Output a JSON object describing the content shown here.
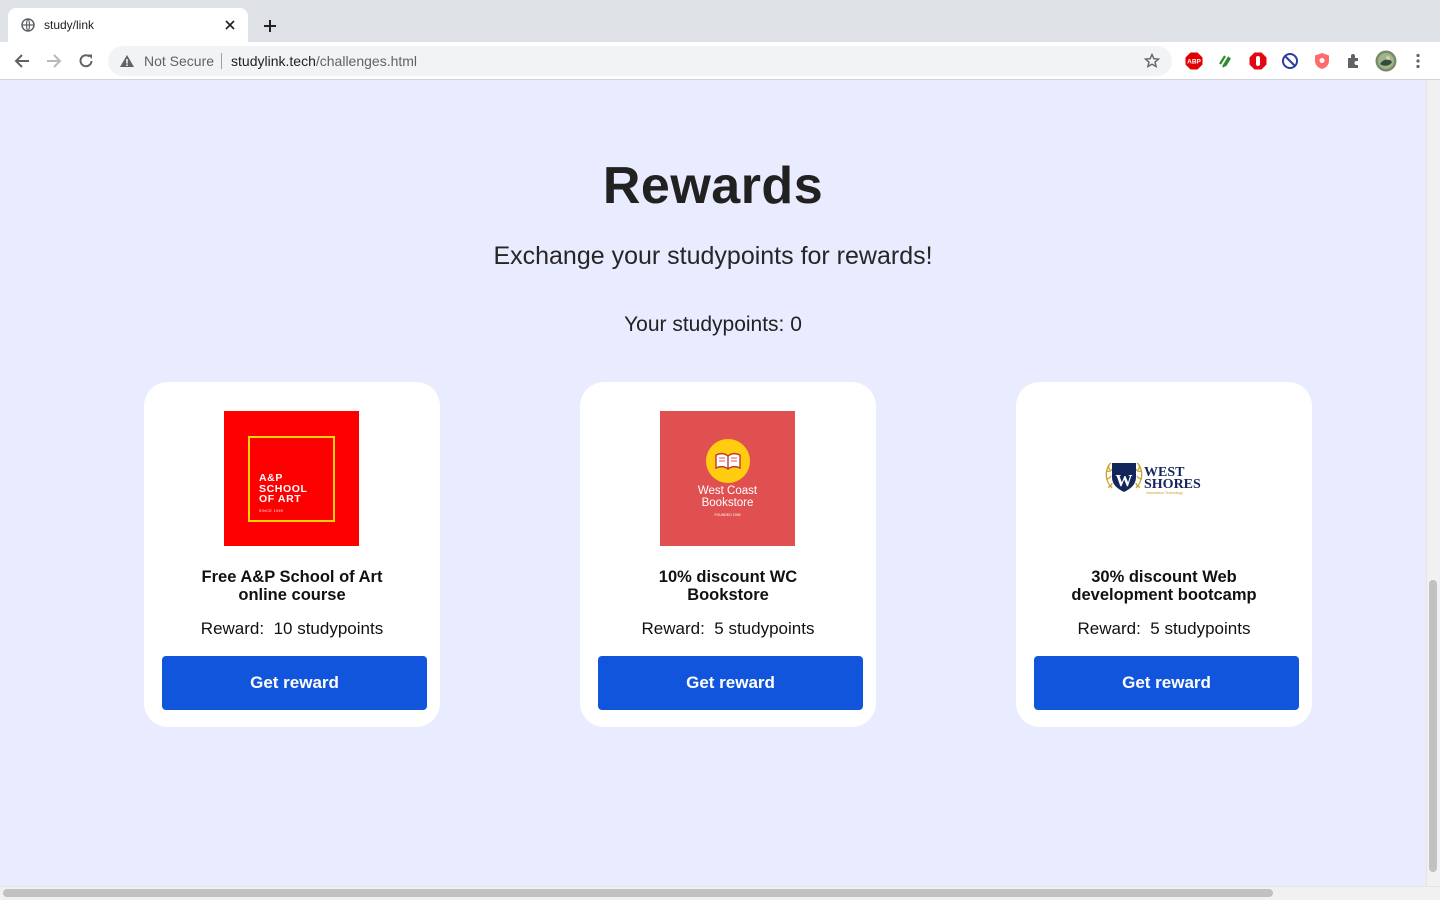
{
  "browser": {
    "tab_title": "study/link",
    "security_label": "Not Secure",
    "url_domain": "studylink.tech",
    "url_path": "/challenges.html"
  },
  "page": {
    "title": "Rewards",
    "subtitle": "Exchange your studypoints for rewards!",
    "points_label": "Your studypoints:",
    "points_value": "0"
  },
  "rewards": [
    {
      "name_line1": "Free A&P School of Art",
      "name_line2": "online course",
      "reward_label": "Reward:",
      "reward_points": "10 studypoints",
      "button_label": "Get reward",
      "logo": {
        "line1": "A&P",
        "line2": "SCHOOL",
        "line3": "OF ART",
        "since": "SINCE 1990"
      }
    },
    {
      "name_line1": "10% discount WC",
      "name_line2": "Bookstore",
      "reward_label": "Reward:",
      "reward_points": "5 studypoints",
      "button_label": "Get reward",
      "logo": {
        "line1": "West Coast",
        "line2": "Bookstore",
        "since": "FOUNDED 1996"
      }
    },
    {
      "name_line1": "30% discount Web",
      "name_line2": "development bootcamp",
      "reward_label": "Reward:",
      "reward_points": "5 studypoints",
      "button_label": "Get reward",
      "logo": {
        "line1": "WEST",
        "line2": "SHORES",
        "line3": "Information Technology",
        "mark": "W"
      }
    }
  ],
  "colors": {
    "page_bg": "#e9ebff",
    "button": "#1155dd",
    "card": "#ffffff"
  }
}
